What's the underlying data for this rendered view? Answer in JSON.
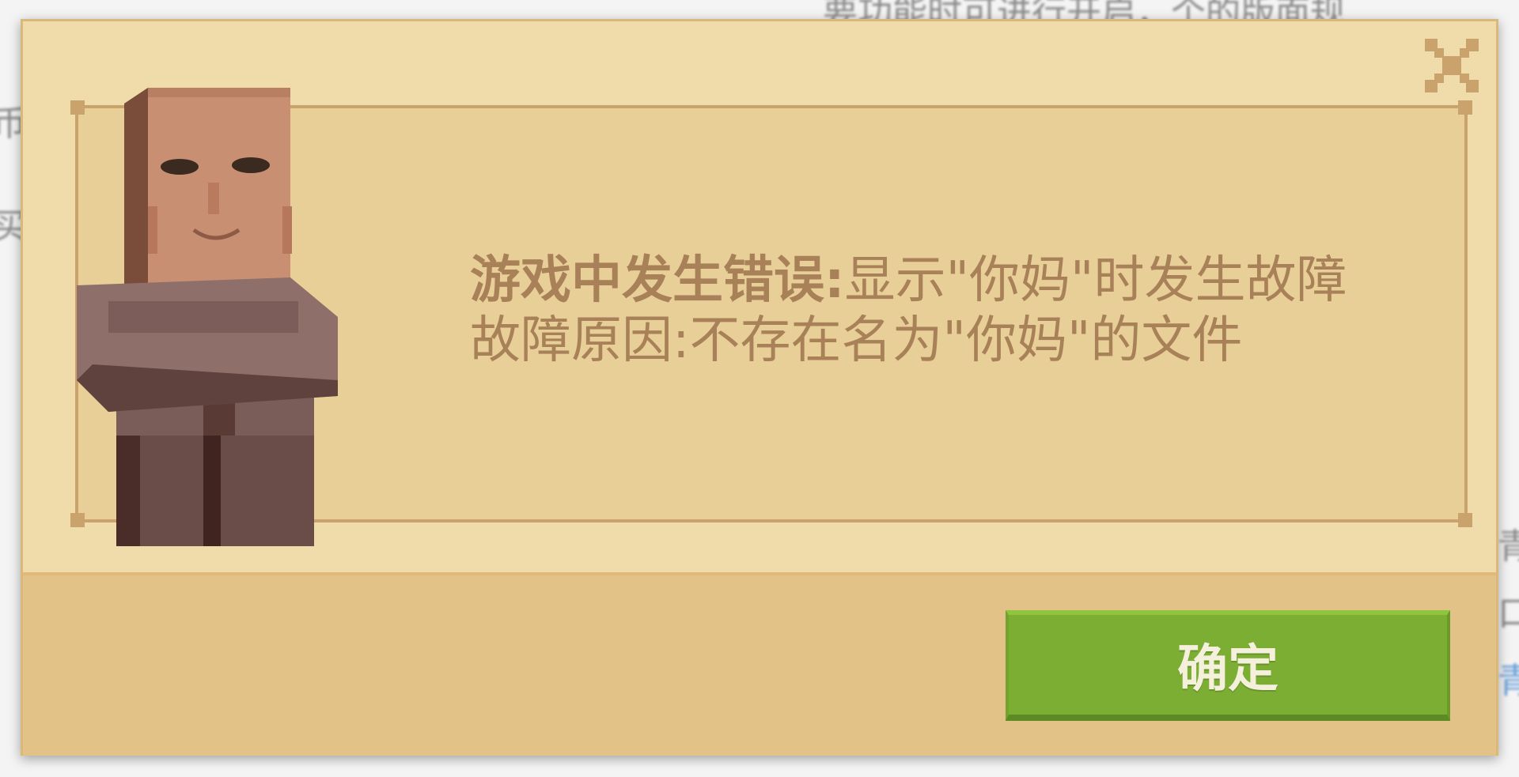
{
  "background": {
    "top_fragment": "要功能时可进行开启，个的版面规",
    "left_fragment_1": "币",
    "left_fragment_2": "买",
    "right_fragment_1": "青",
    "right_fragment_2": "口",
    "right_fragment_3": "青"
  },
  "dialog": {
    "message_line1_bold": "游戏中发生错误:",
    "message_line1_rest": "显示\"你妈\"时发生故障",
    "message_line2": "故障原因:不存在名为\"你妈\"的文件",
    "confirm_label": "确定",
    "close_icon": "close-icon",
    "colors": {
      "dialog_bg": "#f0dcab",
      "panel_bg": "#e8cf98",
      "footer_bg": "#e3c287",
      "text": "#a88158",
      "button": "#7cae33"
    }
  }
}
